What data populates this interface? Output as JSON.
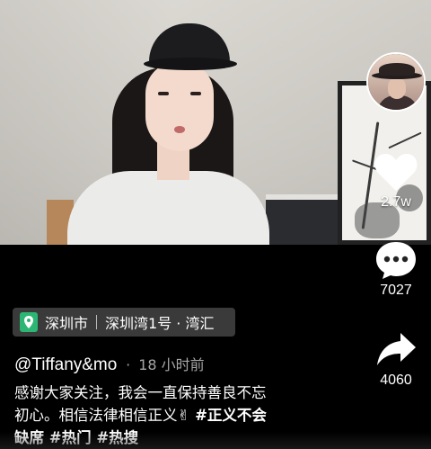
{
  "video": {
    "description_icons": [
      "person-in-cap",
      "picture-frame",
      "cabinet"
    ]
  },
  "actions": {
    "like_count": "2.7w",
    "comment_count": "7027",
    "share_count": "4060"
  },
  "location": {
    "city": "深圳市",
    "place": "深圳湾1号 · 湾汇",
    "icon": "location-pin-icon",
    "icon_color": "#2bb673"
  },
  "author": {
    "handle": "@Tiffany&mo",
    "time": "18 小时前"
  },
  "caption": {
    "line1": "感谢大家关注，我会一直保持善良不忘",
    "line2_text": "初心。相信法律相信正义",
    "line2_emoji": "✌",
    "line2_tag": " #正义不会",
    "line3_tag": "缺席 #热门 #热搜"
  }
}
